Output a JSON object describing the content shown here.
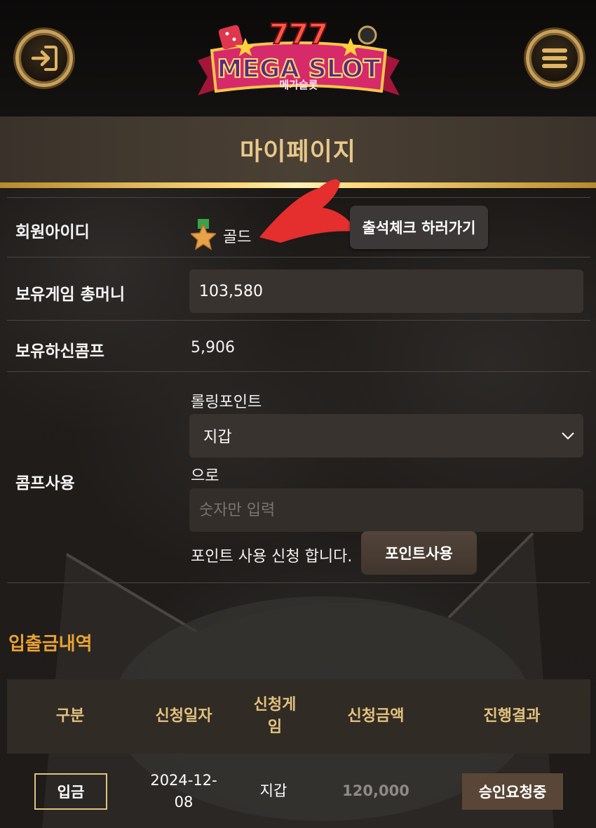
{
  "header": {
    "logo_text": "MEGA SLOT",
    "logo_subtext": "메가슬롯",
    "login_icon": "login-arrow-icon",
    "menu_icon": "hamburger-menu-icon"
  },
  "page_title": "마이페이지",
  "member": {
    "id_label": "회원아이디",
    "level_icon": "star-medal-icon",
    "level_name": "골드",
    "attendance_button": "출석체크 하러가기"
  },
  "money": {
    "label": "보유게임 총머니",
    "value": "103,580"
  },
  "comp": {
    "label": "보유하신콤프",
    "value": "5,906"
  },
  "comp_use": {
    "label": "콤프사용",
    "rolling_label": "롤링포인트",
    "select_value": "지갑",
    "to_label": "으로",
    "amount_placeholder": "숫자만 입력",
    "request_text": "포인트 사용 신청 합니다.",
    "submit_button": "포인트사용"
  },
  "history": {
    "title": "입출금내역",
    "columns": [
      "구분",
      "신청일자",
      "신청게\n임",
      "신청금액",
      "진행결과"
    ],
    "rows": [
      {
        "type": "입금",
        "date": "2024-12-\n08",
        "game": "지갑",
        "amount": "120,000",
        "status": "승인요청중"
      }
    ]
  },
  "colors": {
    "gold_text": "#e7c88b",
    "section_orange": "#e9a233",
    "status_brown": "#5a4636"
  }
}
